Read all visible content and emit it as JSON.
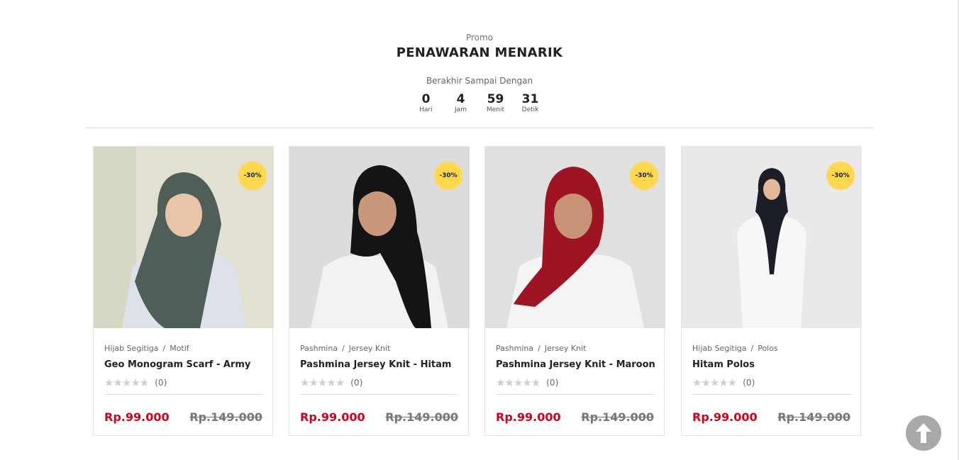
{
  "section": {
    "eyebrow": "Promo",
    "title": "PENAWARAN MENARIK",
    "ends_label": "Berakhir Sampai Dengan"
  },
  "countdown": [
    {
      "value": "0",
      "label": "Hari"
    },
    {
      "value": "4",
      "label": "Jam"
    },
    {
      "value": "59",
      "label": "Menit"
    },
    {
      "value": "31",
      "label": "Detik"
    }
  ],
  "products": [
    {
      "category": "Hijab Segitiga",
      "subcategory": "Motif",
      "name": "Geo Monogram Scarf - Army",
      "discount": "-30%",
      "stars": "★★★★★",
      "rating_count": "(0)",
      "price": "Rp.99.000",
      "old_price": "Rp.149.000",
      "hijab_color": "#4f5e58"
    },
    {
      "category": "Pashmina",
      "subcategory": "Jersey Knit",
      "name": "Pashmina Jersey Knit - Hitam",
      "discount": "-30%",
      "stars": "★★★★★",
      "rating_count": "(0)",
      "price": "Rp.99.000",
      "old_price": "Rp.149.000",
      "hijab_color": "#141414"
    },
    {
      "category": "Pashmina",
      "subcategory": "Jersey Knit",
      "name": "Pashmina Jersey Knit - Maroon",
      "discount": "-30%",
      "stars": "★★★★★",
      "rating_count": "(0)",
      "price": "Rp.99.000",
      "old_price": "Rp.149.000",
      "hijab_color": "#9e1422"
    },
    {
      "category": "Hijab Segitiga",
      "subcategory": "Polos",
      "name": "Hitam Polos",
      "discount": "-30%",
      "stars": "★★★★★",
      "rating_count": "(0)",
      "price": "Rp.99.000",
      "old_price": "Rp.149.000",
      "hijab_color": "#1b1e26"
    }
  ],
  "colors": {
    "price": "#d0021b",
    "badge": "#ffd84d",
    "scroll_button": "#a9a9a9"
  },
  "icons": {
    "scroll_top": "arrow-up-icon",
    "rating": "star-icon"
  }
}
